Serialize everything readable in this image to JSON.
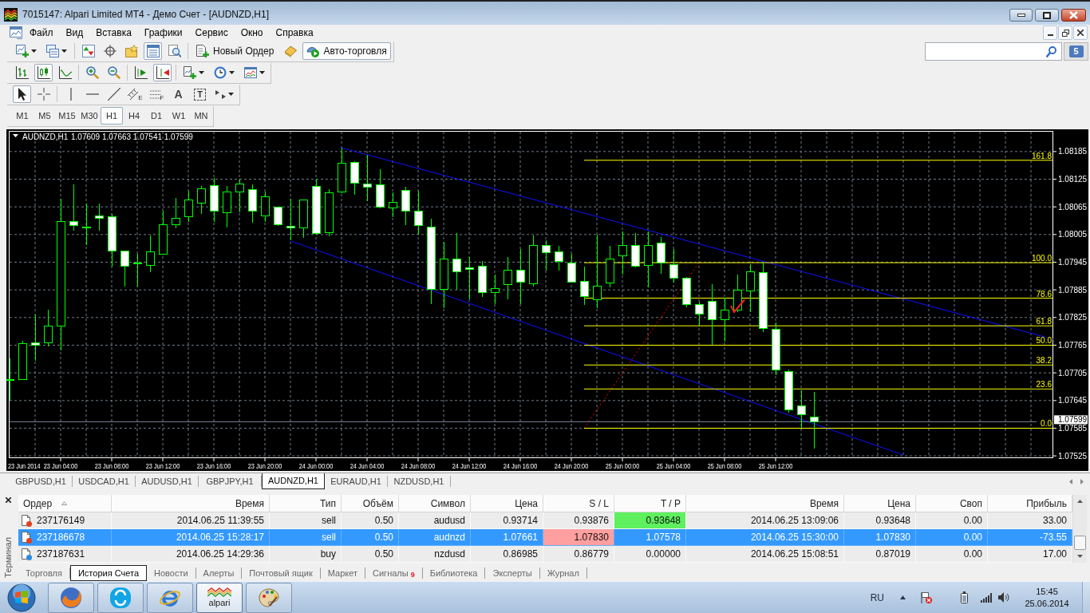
{
  "window": {
    "title": "7015147: Alpari Limited MT4 - Демо Счет - [AUDNZD,H1]"
  },
  "menu": [
    "Файл",
    "Вид",
    "Вставка",
    "Графики",
    "Сервис",
    "Окно",
    "Справка"
  ],
  "toolbars": [
    {
      "groups": [
        [
          {
            "kind": "new-chart",
            "pressed": false
          },
          {
            "kind": "profiles",
            "pressed": false
          }
        ],
        [
          {
            "kind": "market-watch",
            "pressed": false
          },
          {
            "kind": "navigator",
            "pressed": false
          },
          {
            "kind": "favorites",
            "pressed": false
          },
          {
            "kind": "terminal",
            "pressed": true
          },
          {
            "kind": "tester",
            "pressed": false
          }
        ],
        [
          {
            "kind": "new-order",
            "label": "Новый Ордер",
            "pressed": false
          },
          {
            "kind": "editor",
            "pressed": false
          },
          {
            "kind": "auto-trading",
            "label": "Авто-торговля",
            "pressed": true
          }
        ]
      ]
    },
    {
      "groups": [
        [
          {
            "kind": "bars",
            "pressed": false
          },
          {
            "kind": "candles",
            "pressed": true
          },
          {
            "kind": "line",
            "pressed": false
          }
        ],
        [
          {
            "kind": "zoom-in",
            "pressed": false
          },
          {
            "kind": "zoom-out",
            "pressed": false
          }
        ],
        [
          {
            "kind": "chart-shift",
            "pressed": false
          },
          {
            "kind": "autoscroll",
            "pressed": true
          }
        ],
        [
          {
            "kind": "indicators",
            "pressed": false
          },
          {
            "kind": "periods",
            "pressed": false
          },
          {
            "kind": "templates",
            "pressed": false
          }
        ]
      ]
    },
    {
      "groups": [
        [
          {
            "kind": "cursor",
            "pressed": true
          },
          {
            "kind": "crosshair",
            "pressed": false
          }
        ],
        [
          {
            "kind": "vline",
            "pressed": false
          },
          {
            "kind": "hline",
            "pressed": false
          },
          {
            "kind": "trendline",
            "pressed": false
          },
          {
            "kind": "channel",
            "glyph": "E",
            "pressed": false
          },
          {
            "kind": "fibo",
            "glyph": "F",
            "pressed": false
          },
          {
            "kind": "text",
            "glyph": "A",
            "pressed": false
          },
          {
            "kind": "text-label",
            "glyph": "T",
            "pressed": false
          },
          {
            "kind": "arrows",
            "pressed": false
          }
        ]
      ]
    }
  ],
  "timeframes": [
    {
      "label": "M1",
      "selected": false
    },
    {
      "label": "M5",
      "selected": false
    },
    {
      "label": "M15",
      "selected": false
    },
    {
      "label": "M30",
      "selected": false
    },
    {
      "label": "H1",
      "selected": true
    },
    {
      "label": "H4",
      "selected": false
    },
    {
      "label": "D1",
      "selected": false
    },
    {
      "label": "W1",
      "selected": false
    },
    {
      "label": "MN",
      "selected": false
    }
  ],
  "messages": "5",
  "chart": {
    "symbol": "AUDNZD,H1",
    "quote": "1.07609 1.07663 1.07541 1.07599",
    "chart_data": [
      {
        "type": "candlestick",
        "grid": true,
        "xlim": [
          "2014-06-23T00:00",
          "2014-06-26T09:45"
        ],
        "ylim": [
          1.0752,
          1.08228
        ],
        "annotations": [
          "23 Jun 2014"
        ],
        "xticks": [
          {
            "value": "2014-06-23T04:00",
            "label": "23 Jun 04:00"
          },
          {
            "value": "2014-06-23T08:00",
            "label": "23 Jun 08:00"
          },
          {
            "value": "2014-06-23T12:00",
            "label": "23 Jun 12:00"
          },
          {
            "value": "2014-06-23T16:00",
            "label": "23 Jun 16:00"
          },
          {
            "value": "2014-06-23T20:00",
            "label": "23 Jun 20:00"
          },
          {
            "value": "2014-06-24T00:00",
            "label": "24 Jun 00:00"
          },
          {
            "value": "2014-06-24T04:00",
            "label": "24 Jun 04:00"
          },
          {
            "value": "2014-06-24T08:00",
            "label": "24 Jun 08:00"
          },
          {
            "value": "2014-06-24T12:00",
            "label": "24 Jun 12:00"
          },
          {
            "value": "2014-06-24T16:00",
            "label": "24 Jun 16:00"
          },
          {
            "value": "2014-06-24T20:00",
            "label": "24 Jun 20:00"
          },
          {
            "value": "2014-06-25T00:00",
            "label": "25 Jun 00:00"
          },
          {
            "value": "2014-06-25T04:00",
            "label": "25 Jun 04:00"
          },
          {
            "value": "2014-06-25T08:00",
            "label": "25 Jun 08:00"
          },
          {
            "value": "2014-06-25T12:00",
            "label": "25 Jun 12:00"
          }
        ],
        "yticks": [
          1.08185,
          1.08125,
          1.08065,
          1.08005,
          1.07945,
          1.07885,
          1.07825,
          1.07765,
          1.07705,
          1.07645,
          1.07585,
          1.07525
        ],
        "x": [
          "2014-06-23T00:00",
          "2014-06-23T01:00",
          "2014-06-23T02:00",
          "2014-06-23T03:00",
          "2014-06-23T04:00",
          "2014-06-23T05:00",
          "2014-06-23T06:00",
          "2014-06-23T07:00",
          "2014-06-23T08:00",
          "2014-06-23T09:00",
          "2014-06-23T10:00",
          "2014-06-23T11:00",
          "2014-06-23T12:00",
          "2014-06-23T13:00",
          "2014-06-23T14:00",
          "2014-06-23T15:00",
          "2014-06-23T16:00",
          "2014-06-23T17:00",
          "2014-06-23T18:00",
          "2014-06-23T19:00",
          "2014-06-23T20:00",
          "2014-06-23T21:00",
          "2014-06-23T22:00",
          "2014-06-23T23:00",
          "2014-06-24T00:00",
          "2014-06-24T01:00",
          "2014-06-24T02:00",
          "2014-06-24T03:00",
          "2014-06-24T04:00",
          "2014-06-24T05:00",
          "2014-06-24T06:00",
          "2014-06-24T07:00",
          "2014-06-24T08:00",
          "2014-06-24T09:00",
          "2014-06-24T10:00",
          "2014-06-24T11:00",
          "2014-06-24T12:00",
          "2014-06-24T13:00",
          "2014-06-24T14:00",
          "2014-06-24T15:00",
          "2014-06-24T16:00",
          "2014-06-24T17:00",
          "2014-06-24T18:00",
          "2014-06-24T19:00",
          "2014-06-24T20:00",
          "2014-06-24T21:00",
          "2014-06-24T22:00",
          "2014-06-24T23:00",
          "2014-06-25T00:00",
          "2014-06-25T01:00",
          "2014-06-25T02:00",
          "2014-06-25T03:00",
          "2014-06-25T04:00",
          "2014-06-25T05:00",
          "2014-06-25T06:00",
          "2014-06-25T07:00",
          "2014-06-25T08:00",
          "2014-06-25T09:00",
          "2014-06-25T10:00",
          "2014-06-25T11:00",
          "2014-06-25T12:00",
          "2014-06-25T13:00",
          "2014-06-25T14:00",
          "2014-06-25T15:00"
        ],
        "ohlc": [
          [
            1.0769,
            1.07736,
            1.07645,
            1.0769
          ],
          [
            1.0769,
            1.07775,
            1.0769,
            1.07768
          ],
          [
            1.0777,
            1.07832,
            1.07731,
            1.07765
          ],
          [
            1.07771,
            1.07842,
            1.07763,
            1.07806
          ],
          [
            1.07806,
            1.08082,
            1.07754,
            1.08034
          ],
          [
            1.08034,
            1.08114,
            1.08014,
            1.08025
          ],
          [
            1.08022,
            1.08073,
            1.07982,
            1.0802
          ],
          [
            1.08045,
            1.08073,
            1.08014,
            1.08041
          ],
          [
            1.08044,
            1.0805,
            1.07936,
            1.0797
          ],
          [
            1.0797,
            1.0797,
            1.07893,
            1.07936
          ],
          [
            1.07944,
            1.07964,
            1.07893,
            1.07943
          ],
          [
            1.07938,
            1.08003,
            1.07923,
            1.07967
          ],
          [
            1.07963,
            1.08056,
            1.07962,
            1.08026
          ],
          [
            1.08027,
            1.08085,
            1.08018,
            1.08041
          ],
          [
            1.08044,
            1.081,
            1.08032,
            1.0808
          ],
          [
            1.08073,
            1.08111,
            1.0805,
            1.08105
          ],
          [
            1.08111,
            1.08127,
            1.08032,
            1.08056
          ],
          [
            1.08053,
            1.08111,
            1.0802,
            1.08097
          ],
          [
            1.08098,
            1.08126,
            1.08053,
            1.08115
          ],
          [
            1.08103,
            1.08114,
            1.0803,
            1.08056
          ],
          [
            1.08045,
            1.08098,
            1.08032,
            1.08087
          ],
          [
            1.08064,
            1.08066,
            1.08023,
            1.08026
          ],
          [
            1.08023,
            1.08082,
            1.07993,
            1.08019
          ],
          [
            1.0802,
            1.0808,
            1.07997,
            1.0808
          ],
          [
            1.08109,
            1.08126,
            1.08005,
            1.08007
          ],
          [
            1.08009,
            1.08103,
            1.08002,
            1.08096
          ],
          [
            1.08097,
            1.08193,
            1.08095,
            1.08159
          ],
          [
            1.08161,
            1.08164,
            1.08091,
            1.08116
          ],
          [
            1.08114,
            1.08178,
            1.08077,
            1.08107
          ],
          [
            1.08113,
            1.08147,
            1.08061,
            1.08064
          ],
          [
            1.08062,
            1.08097,
            1.08043,
            1.08075
          ],
          [
            1.08101,
            1.08109,
            1.08026,
            1.08056
          ],
          [
            1.08055,
            1.081,
            1.08005,
            1.08025
          ],
          [
            1.08021,
            1.08039,
            1.07854,
            1.07886
          ],
          [
            1.07886,
            1.07989,
            1.07845,
            1.07952
          ],
          [
            1.07952,
            1.08009,
            1.07886,
            1.07924
          ],
          [
            1.07932,
            1.07956,
            1.07865,
            1.0793
          ],
          [
            1.07936,
            1.07948,
            1.0787,
            1.0788
          ],
          [
            1.0788,
            1.07918,
            1.07854,
            1.07887
          ],
          [
            1.07896,
            1.07956,
            1.07865,
            1.07927
          ],
          [
            1.07927,
            1.07973,
            1.07854,
            1.07902
          ],
          [
            1.07898,
            1.08003,
            1.07893,
            1.07982
          ],
          [
            1.07982,
            1.07993,
            1.07927,
            1.07966
          ],
          [
            1.07968,
            1.0798,
            1.07927,
            1.07947
          ],
          [
            1.07944,
            1.07964,
            1.079,
            1.07902
          ],
          [
            1.07903,
            1.07936,
            1.07852,
            1.0787
          ],
          [
            1.07863,
            1.08005,
            1.07845,
            1.07893
          ],
          [
            1.079,
            1.0798,
            1.07891,
            1.07952
          ],
          [
            1.07959,
            1.08012,
            1.07918,
            1.07982
          ],
          [
            1.07982,
            1.08009,
            1.07934,
            1.07936
          ],
          [
            1.07938,
            1.08011,
            1.07891,
            1.07982
          ],
          [
            1.07986,
            1.08,
            1.0792,
            1.07944
          ],
          [
            1.0794,
            1.07973,
            1.079,
            1.07911
          ],
          [
            1.07911,
            1.07913,
            1.07847,
            1.07854
          ],
          [
            1.07854,
            1.07859,
            1.07807,
            1.07833
          ],
          [
            1.07861,
            1.07898,
            1.07766,
            1.07821
          ],
          [
            1.07821,
            1.07868,
            1.07772,
            1.07841
          ],
          [
            1.07841,
            1.07918,
            1.07836,
            1.07885
          ],
          [
            1.07883,
            1.07941,
            1.07836,
            1.07924
          ],
          [
            1.07923,
            1.07944,
            1.07793,
            1.07801
          ],
          [
            1.078,
            1.07815,
            1.077,
            1.07712
          ],
          [
            1.07707,
            1.07712,
            1.07619,
            1.07625
          ],
          [
            1.07634,
            1.07667,
            1.07586,
            1.07614
          ],
          [
            1.07609,
            1.07663,
            1.07541,
            1.07599
          ]
        ],
        "series": [
          {
            "type": "line",
            "x": [
              "2014-06-24T02:00",
              "2014-06-26T09:45"
            ],
            "values": [
              1.08193,
              1.07778
            ],
            "color": "#1010ff"
          },
          {
            "type": "line",
            "x": [
              "2014-06-23T22:00",
              "2014-06-25T22:00"
            ],
            "values": [
              1.07991,
              1.07527
            ],
            "color": "#1010ff"
          },
          {
            "type": "line",
            "x": [
              "2014-06-24T21:00",
              "2014-06-25T06:00"
            ],
            "values": [
              1.07585,
              1.07944
            ],
            "color": "#ff0000",
            "line_style": "dotted"
          },
          {
            "name": "161.8",
            "type": "line",
            "x": [
              "2014-06-24T21:00",
              "2014-06-26T09:45"
            ],
            "values": [
              1.08166,
              1.08166
            ],
            "color": "#ffff00"
          },
          {
            "name": "100.0",
            "type": "line",
            "x": [
              "2014-06-24T21:00",
              "2014-06-26T09:45"
            ],
            "values": [
              1.07944,
              1.07944
            ],
            "color": "#ffff00"
          },
          {
            "name": "78.6",
            "type": "line",
            "x": [
              "2014-06-24T21:00",
              "2014-06-26T09:45"
            ],
            "values": [
              1.07867,
              1.07867
            ],
            "color": "#ffff00"
          },
          {
            "name": "61.8",
            "type": "line",
            "x": [
              "2014-06-24T21:00",
              "2014-06-26T09:45"
            ],
            "values": [
              1.07807,
              1.07807
            ],
            "color": "#ffff00"
          },
          {
            "name": "50.0",
            "type": "line",
            "x": [
              "2014-06-24T21:00",
              "2014-06-26T09:45"
            ],
            "values": [
              1.07765,
              1.07765
            ],
            "color": "#ffff00"
          },
          {
            "name": "38.2",
            "type": "line",
            "x": [
              "2014-06-24T21:00",
              "2014-06-26T09:45"
            ],
            "values": [
              1.07722,
              1.07722
            ],
            "color": "#ffff00"
          },
          {
            "name": "23.6",
            "type": "line",
            "x": [
              "2014-06-24T21:00",
              "2014-06-26T09:45"
            ],
            "values": [
              1.0767,
              1.0767
            ],
            "color": "#ffff00"
          },
          {
            "name": "0.0",
            "type": "line",
            "x": [
              "2014-06-24T21:00",
              "2014-06-26T09:45"
            ],
            "values": [
              1.07585,
              1.07585
            ],
            "color": "#ffff00"
          }
        ],
        "ref_lines": [
          {
            "axis": "y",
            "value": 1.07599,
            "label": "1.07599",
            "color": "#778899"
          }
        ]
      }
    ]
  },
  "chart_tabs": [
    {
      "label": "GBPUSD,H1",
      "selected": false
    },
    {
      "label": "USDCAD,H1",
      "selected": false
    },
    {
      "label": "AUDUSD,H1",
      "selected": false
    },
    {
      "label": "GBPJPY,H1",
      "selected": false
    },
    {
      "label": "AUDNZD,H1",
      "selected": true
    },
    {
      "label": "EURAUD,H1",
      "selected": false
    },
    {
      "label": "NZDUSD,H1",
      "selected": false
    }
  ],
  "terminal": {
    "title": "Терминал",
    "columns": [
      {
        "label": "Ордер",
        "sorted": true
      },
      {
        "label": "Время",
        "sorted": false
      },
      {
        "label": "Тип",
        "sorted": false
      },
      {
        "label": "Объём",
        "sorted": false
      },
      {
        "label": "Символ",
        "sorted": false
      },
      {
        "label": "Цена",
        "sorted": false
      },
      {
        "label": "S / L",
        "sorted": false
      },
      {
        "label": "T / P",
        "sorted": false
      },
      {
        "label": "Время",
        "sorted": false
      },
      {
        "label": "Цена",
        "sorted": false
      },
      {
        "label": "Своп",
        "sorted": false
      },
      {
        "label": "Прибыль",
        "sorted": false
      }
    ],
    "rows": [
      {
        "cells": [
          "237176149",
          "2014.06.25 11:39:55",
          "sell",
          "0.50",
          "audusd",
          "0.93714",
          "0.93876",
          "0.93648",
          "2014.06.25 13:09:06",
          "0.93648",
          "0.00",
          "33.00"
        ],
        "color": "#e0401c",
        "selected": false,
        "sl_hit": false,
        "tp_hit": true
      },
      {
        "cells": [
          "237186678",
          "2014.06.25 15:28:17",
          "sell",
          "0.50",
          "audnzd",
          "1.07661",
          "1.07830",
          "1.07578",
          "2014.06.25 15:30:00",
          "1.07830",
          "0.00",
          "-73.55"
        ],
        "color": "#e0401c",
        "selected": true,
        "sl_hit": true,
        "tp_hit": false
      },
      {
        "cells": [
          "237187631",
          "2014.06.25 14:29:36",
          "buy",
          "0.50",
          "nzdusd",
          "0.86985",
          "0.86779",
          "0.00000",
          "2014.06.25 15:08:51",
          "0.87019",
          "0.00",
          "17.00"
        ],
        "color": "#2a8ae0",
        "selected": false,
        "sl_hit": false,
        "tp_hit": false
      }
    ],
    "tabs": [
      {
        "label": "Торговля",
        "selected": false
      },
      {
        "label": "История Счета",
        "selected": true
      },
      {
        "label": "Новости",
        "selected": false
      },
      {
        "label": "Алерты",
        "selected": false
      },
      {
        "label": "Почтовый ящик",
        "selected": false
      },
      {
        "label": "Маркет",
        "selected": false
      },
      {
        "label": "Сигналы",
        "badge": "9",
        "selected": false
      },
      {
        "label": "Библиотека",
        "selected": false
      },
      {
        "label": "Эксперты",
        "selected": false
      },
      {
        "label": "Журнал",
        "selected": false
      }
    ]
  },
  "taskbar": {
    "apps": [
      {
        "kind": "globe",
        "active": false
      },
      {
        "kind": "swirl",
        "active": false
      },
      {
        "kind": "ring",
        "active": false
      },
      {
        "kind": "zigzag",
        "label": "alpari",
        "active": true
      },
      {
        "kind": "palette",
        "active": false
      }
    ],
    "tray": {
      "language": "RU",
      "time": "15:45",
      "date": "25.06.2014"
    }
  }
}
